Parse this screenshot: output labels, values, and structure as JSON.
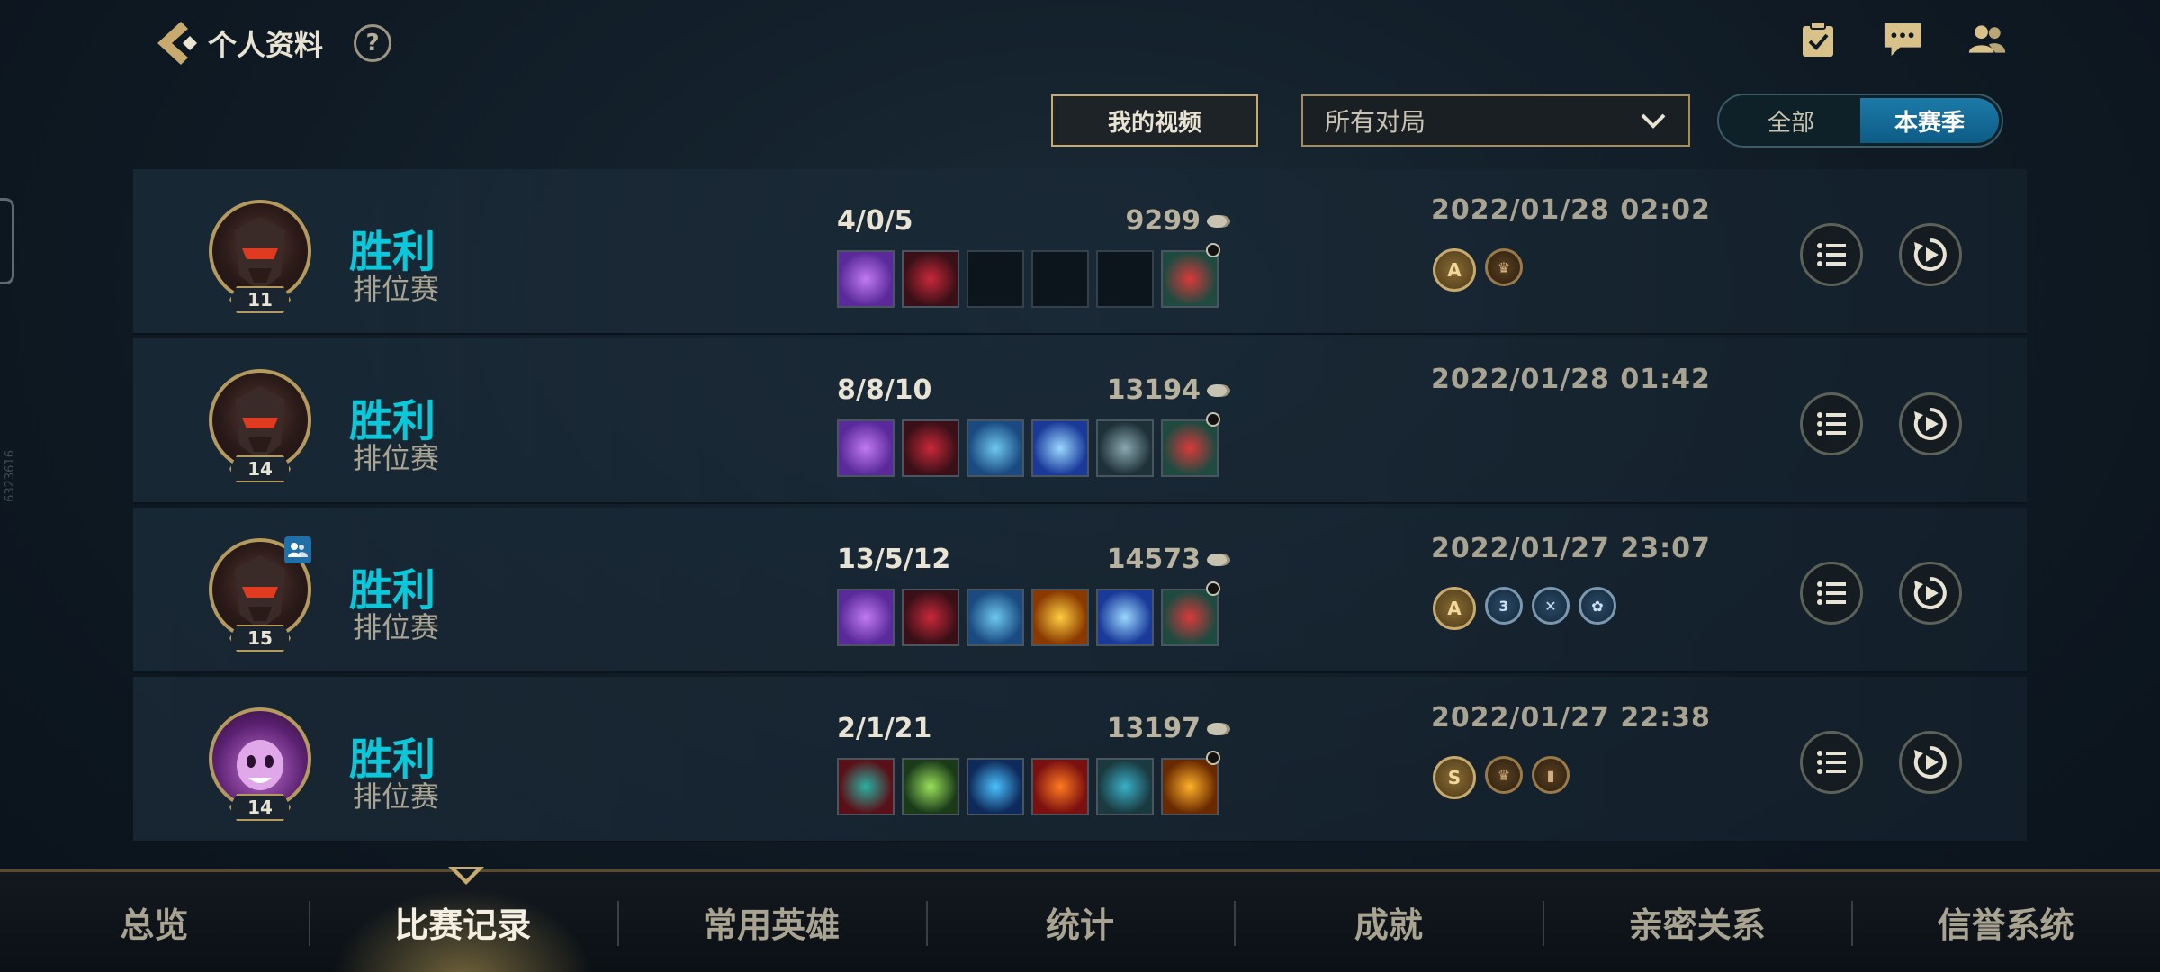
{
  "header": {
    "title": "个人资料",
    "help": "?"
  },
  "filters": {
    "video_button": "我的视频",
    "match_filter": "所有对局",
    "season_toggle": [
      "全部",
      "本赛季"
    ],
    "season_selected": "本赛季"
  },
  "side_id": "6323616",
  "matches": [
    {
      "result": "胜利",
      "mode": "排位赛",
      "level": "11",
      "kda": "4/0/5",
      "gold": "9299",
      "date": "2022/01/28 02:02",
      "items": [
        "purple-sword",
        "dark-blade",
        "",
        "",
        "",
        "red-boots"
      ],
      "badges": [
        {
          "label": "A",
          "style": "gold"
        },
        {
          "label": "♛",
          "style": "bronze"
        }
      ]
    },
    {
      "result": "胜利",
      "mode": "排位赛",
      "level": "14",
      "kda": "8/8/10",
      "gold": "13194",
      "date": "2022/01/28 01:42",
      "items": [
        "purple-sword",
        "dark-blade",
        "blue-bow",
        "ice-blade",
        "grey-sword",
        "red-boots"
      ],
      "badges": []
    },
    {
      "result": "胜利",
      "mode": "排位赛",
      "level": "15",
      "kda": "13/5/12",
      "gold": "14573",
      "date": "2022/01/27 23:07",
      "party": true,
      "items": [
        "purple-sword",
        "dark-blade",
        "blue-bow",
        "fire-orb",
        "ice-blade",
        "red-boots"
      ],
      "badges": [
        {
          "label": "A",
          "style": "gold"
        },
        {
          "label": "3",
          "style": "blue"
        },
        {
          "label": "✕",
          "style": "blue"
        },
        {
          "label": "✿",
          "style": "blue"
        }
      ]
    },
    {
      "result": "胜利",
      "mode": "排位赛",
      "level": "14",
      "kda": "2/1/21",
      "gold": "13197",
      "date": "2022/01/27 22:38",
      "items": [
        "red-helm",
        "green-orb",
        "blue-dragon",
        "red-flame",
        "teal-pouch",
        "sun-burst"
      ],
      "badges": [
        {
          "label": "S",
          "style": "gold"
        },
        {
          "label": "♛",
          "style": "bronze"
        },
        {
          "label": "▮",
          "style": "bronze"
        }
      ]
    }
  ],
  "nav": {
    "tabs": [
      "总览",
      "比赛记录",
      "常用英雄",
      "统计",
      "成就",
      "亲密关系",
      "信誉系统"
    ],
    "active_index": 1
  },
  "colors": {
    "accent_gold": "#c8aa6e",
    "win_cyan": "#0ac8d9",
    "active_blue": "#1c7aa8"
  }
}
